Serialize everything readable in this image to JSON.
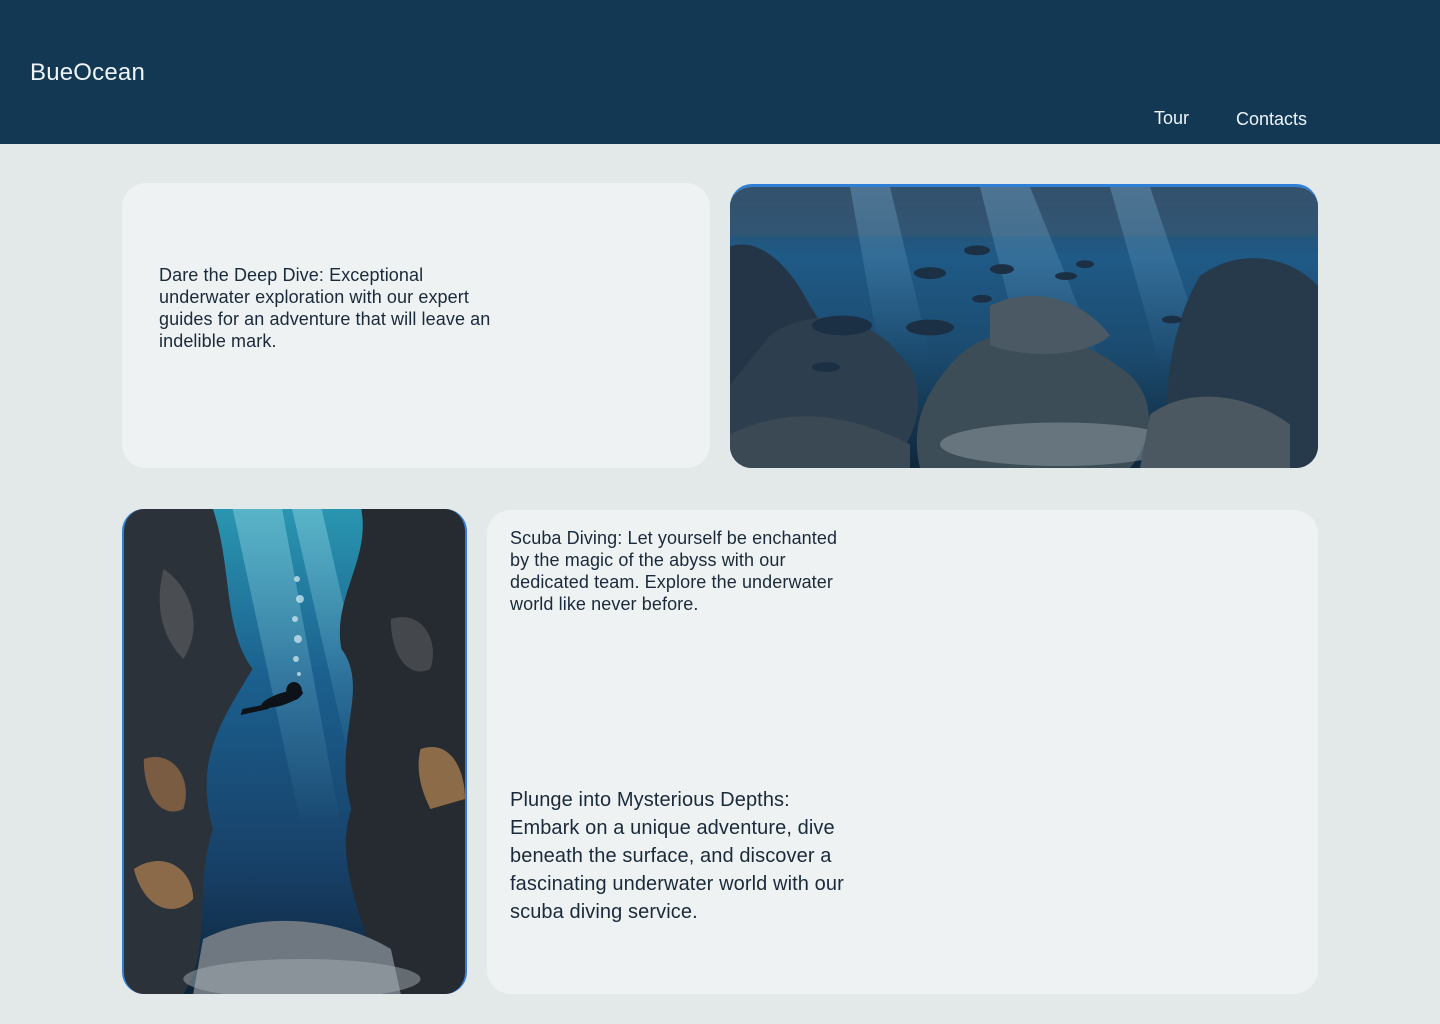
{
  "header": {
    "logo": "BueOcean",
    "nav": [
      {
        "label": "Tour"
      },
      {
        "label": "Contacts"
      }
    ]
  },
  "cards": {
    "deep_dive_text": "Dare the Deep Dive: Exceptional underwater exploration with our expert guides for an adventure that will leave an indelible mark.",
    "scuba_text": "Scuba Diving: Let  yourself be enchanted by the magic of the abyss with our dedicated team. Explore the underwater world like never before.",
    "plunge_text": "Plunge into Mysterious Depths: Embark on a unique adventure, dive beneath the surface, and discover a fascinating underwater world with our scuba diving service."
  },
  "colors": {
    "header_bg": "#123854",
    "page_bg": "#e3e8e8",
    "card_bg": "#eef2f3",
    "accent": "#2f7fd6"
  }
}
